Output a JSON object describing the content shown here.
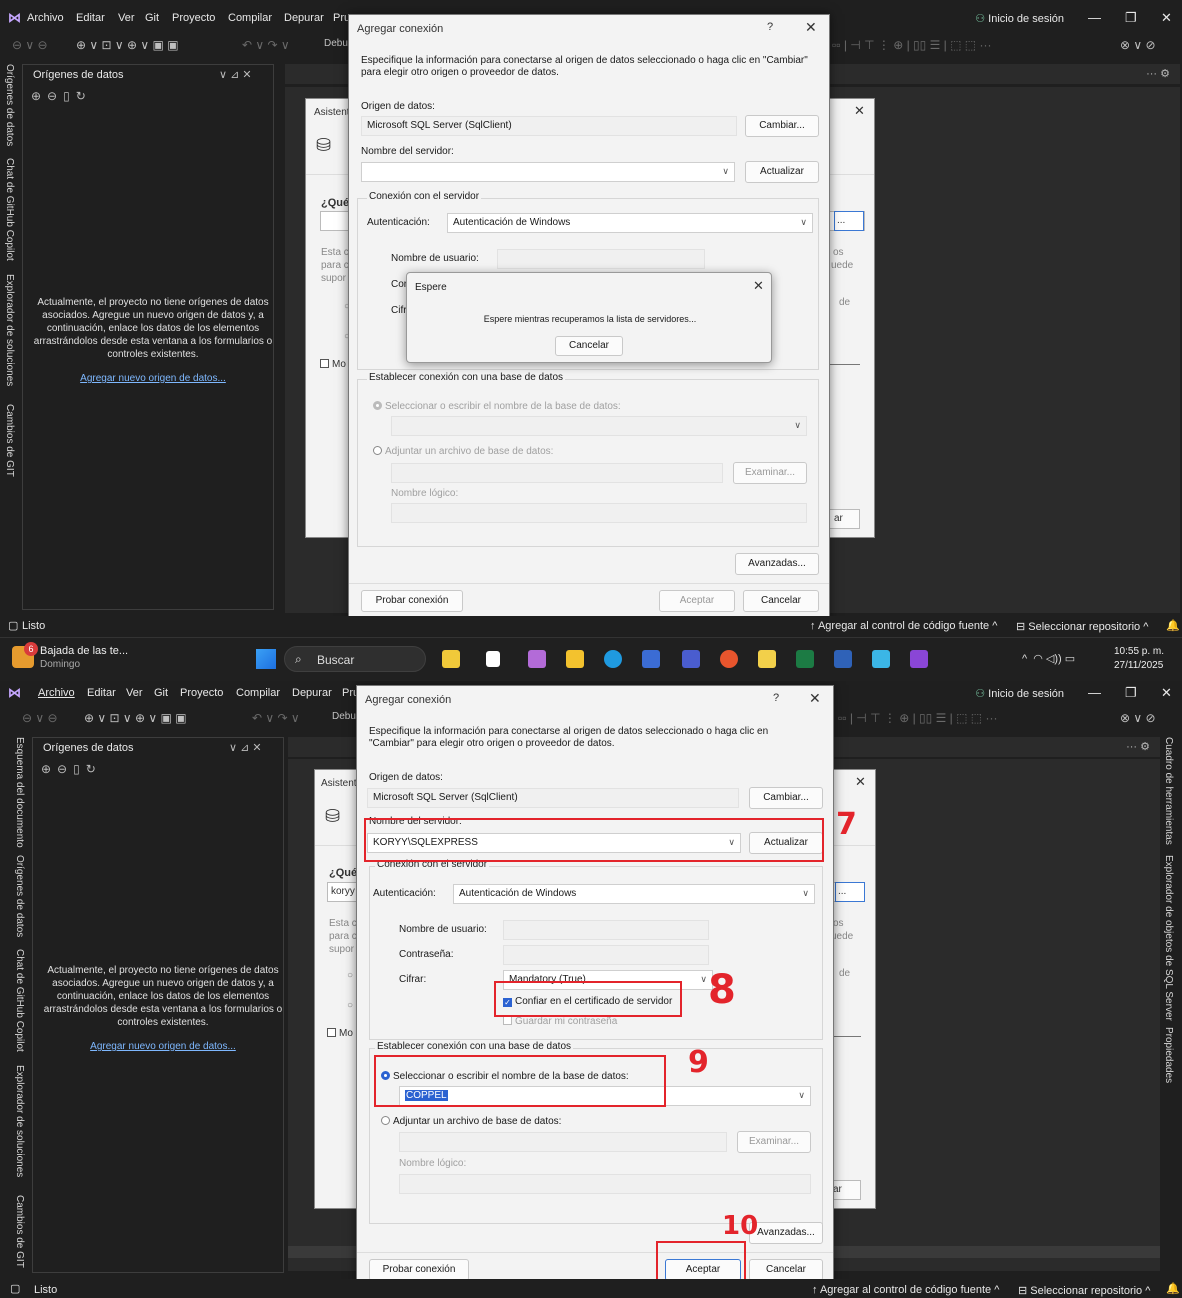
{
  "menu": [
    "Archivo",
    "Editar",
    "Ver",
    "Git",
    "Proyecto",
    "Compilar",
    "Depurar",
    "Pru"
  ],
  "signin": "Inicio de sesión",
  "toolbar_fragment": "Debu",
  "panel_title": "Orígenes de datos",
  "empty_msg": "Actualmente, el proyecto no tiene orígenes de datos asociados. Agregue un nuevo origen de datos y, a continuación, enlace los datos de los elementos arrastrándolos desde esta ventana a los formularios o controles existentes.",
  "add_link": "Agregar nuevo origen de datos...",
  "side_tabs_top": [
    "Orígenes de datos",
    "Chat de GitHub Copilot",
    "Explorador de soluciones",
    "Cambios de GIT"
  ],
  "side_tabs_bottom": [
    "Esquema del documento",
    "Orígenes de datos",
    "Chat de GitHub Copilot",
    "Explorador de soluciones",
    "Cambios de GIT"
  ],
  "right_tabs_bottom": [
    "Cuadro de herramientas",
    "Explorador de objetos de SQL Server",
    "Propiedades"
  ],
  "wizard": {
    "title_frag": "Asistent",
    "question": "¿Qué",
    "input_frag": "koryy",
    "desc_lines": [
      "Esta c",
      "para c",
      "supor"
    ],
    "right_frags": [
      "os",
      "uede",
      "de"
    ],
    "check_frag": "Mo",
    "btn_frag": "ar"
  },
  "dialog": {
    "title": "Agregar conexión",
    "help": "?",
    "instructions": "Especifique la información para conectarse al origen de datos seleccionado o haga clic en \"Cambiar\" para elegir otro origen o proveedor de datos.",
    "source_label": "Origen de datos:",
    "source_value": "Microsoft SQL Server (SqlClient)",
    "change_btn": "Cambiar...",
    "server_label": "Nombre del servidor:",
    "server_value_1": "",
    "server_value_2": "KORYY\\SQLEXPRESS",
    "refresh_btn": "Actualizar",
    "conn_group": "Conexión con el servidor",
    "auth_label": "Autenticación:",
    "auth_value": "Autenticación de Windows",
    "user_label": "Nombre de usuario:",
    "pass_label": "Contraseña:",
    "encrypt_label": "Cifrar:",
    "pass_frag": "Cor",
    "encrypt_frag": "Cifr",
    "encrypt_value": "Mandatory (True)",
    "trust_cert": "Confiar en el certificado de servidor",
    "save_pass": "Guardar mi contraseña",
    "db_group": "Establecer conexión con una base de datos",
    "select_db": "Seleccionar o escribir el nombre de la base de datos:",
    "db_value": "COPPEL",
    "attach_db": "Adjuntar un archivo de base de datos:",
    "browse_btn": "Examinar...",
    "logical_name": "Nombre lógico:",
    "advanced_btn": "Avanzadas...",
    "test_btn": "Probar conexión",
    "ok_btn": "Aceptar",
    "cancel_btn": "Cancelar"
  },
  "wait": {
    "title": "Espere",
    "message": "Espere mientras recuperamos la lista de servidores...",
    "cancel": "Cancelar"
  },
  "status": {
    "ready": "Listo",
    "source_control": "Agregar al control de código fuente",
    "repo": "Seleccionar repositorio"
  },
  "taskbar": {
    "notification_count": "6",
    "news_title": "Bajada de las te...",
    "news_sub": "Domingo",
    "search": "Buscar",
    "time": "10:55 p. m.",
    "date": "27/11/2025"
  },
  "annotations": [
    "7",
    "8",
    "9",
    "10"
  ]
}
